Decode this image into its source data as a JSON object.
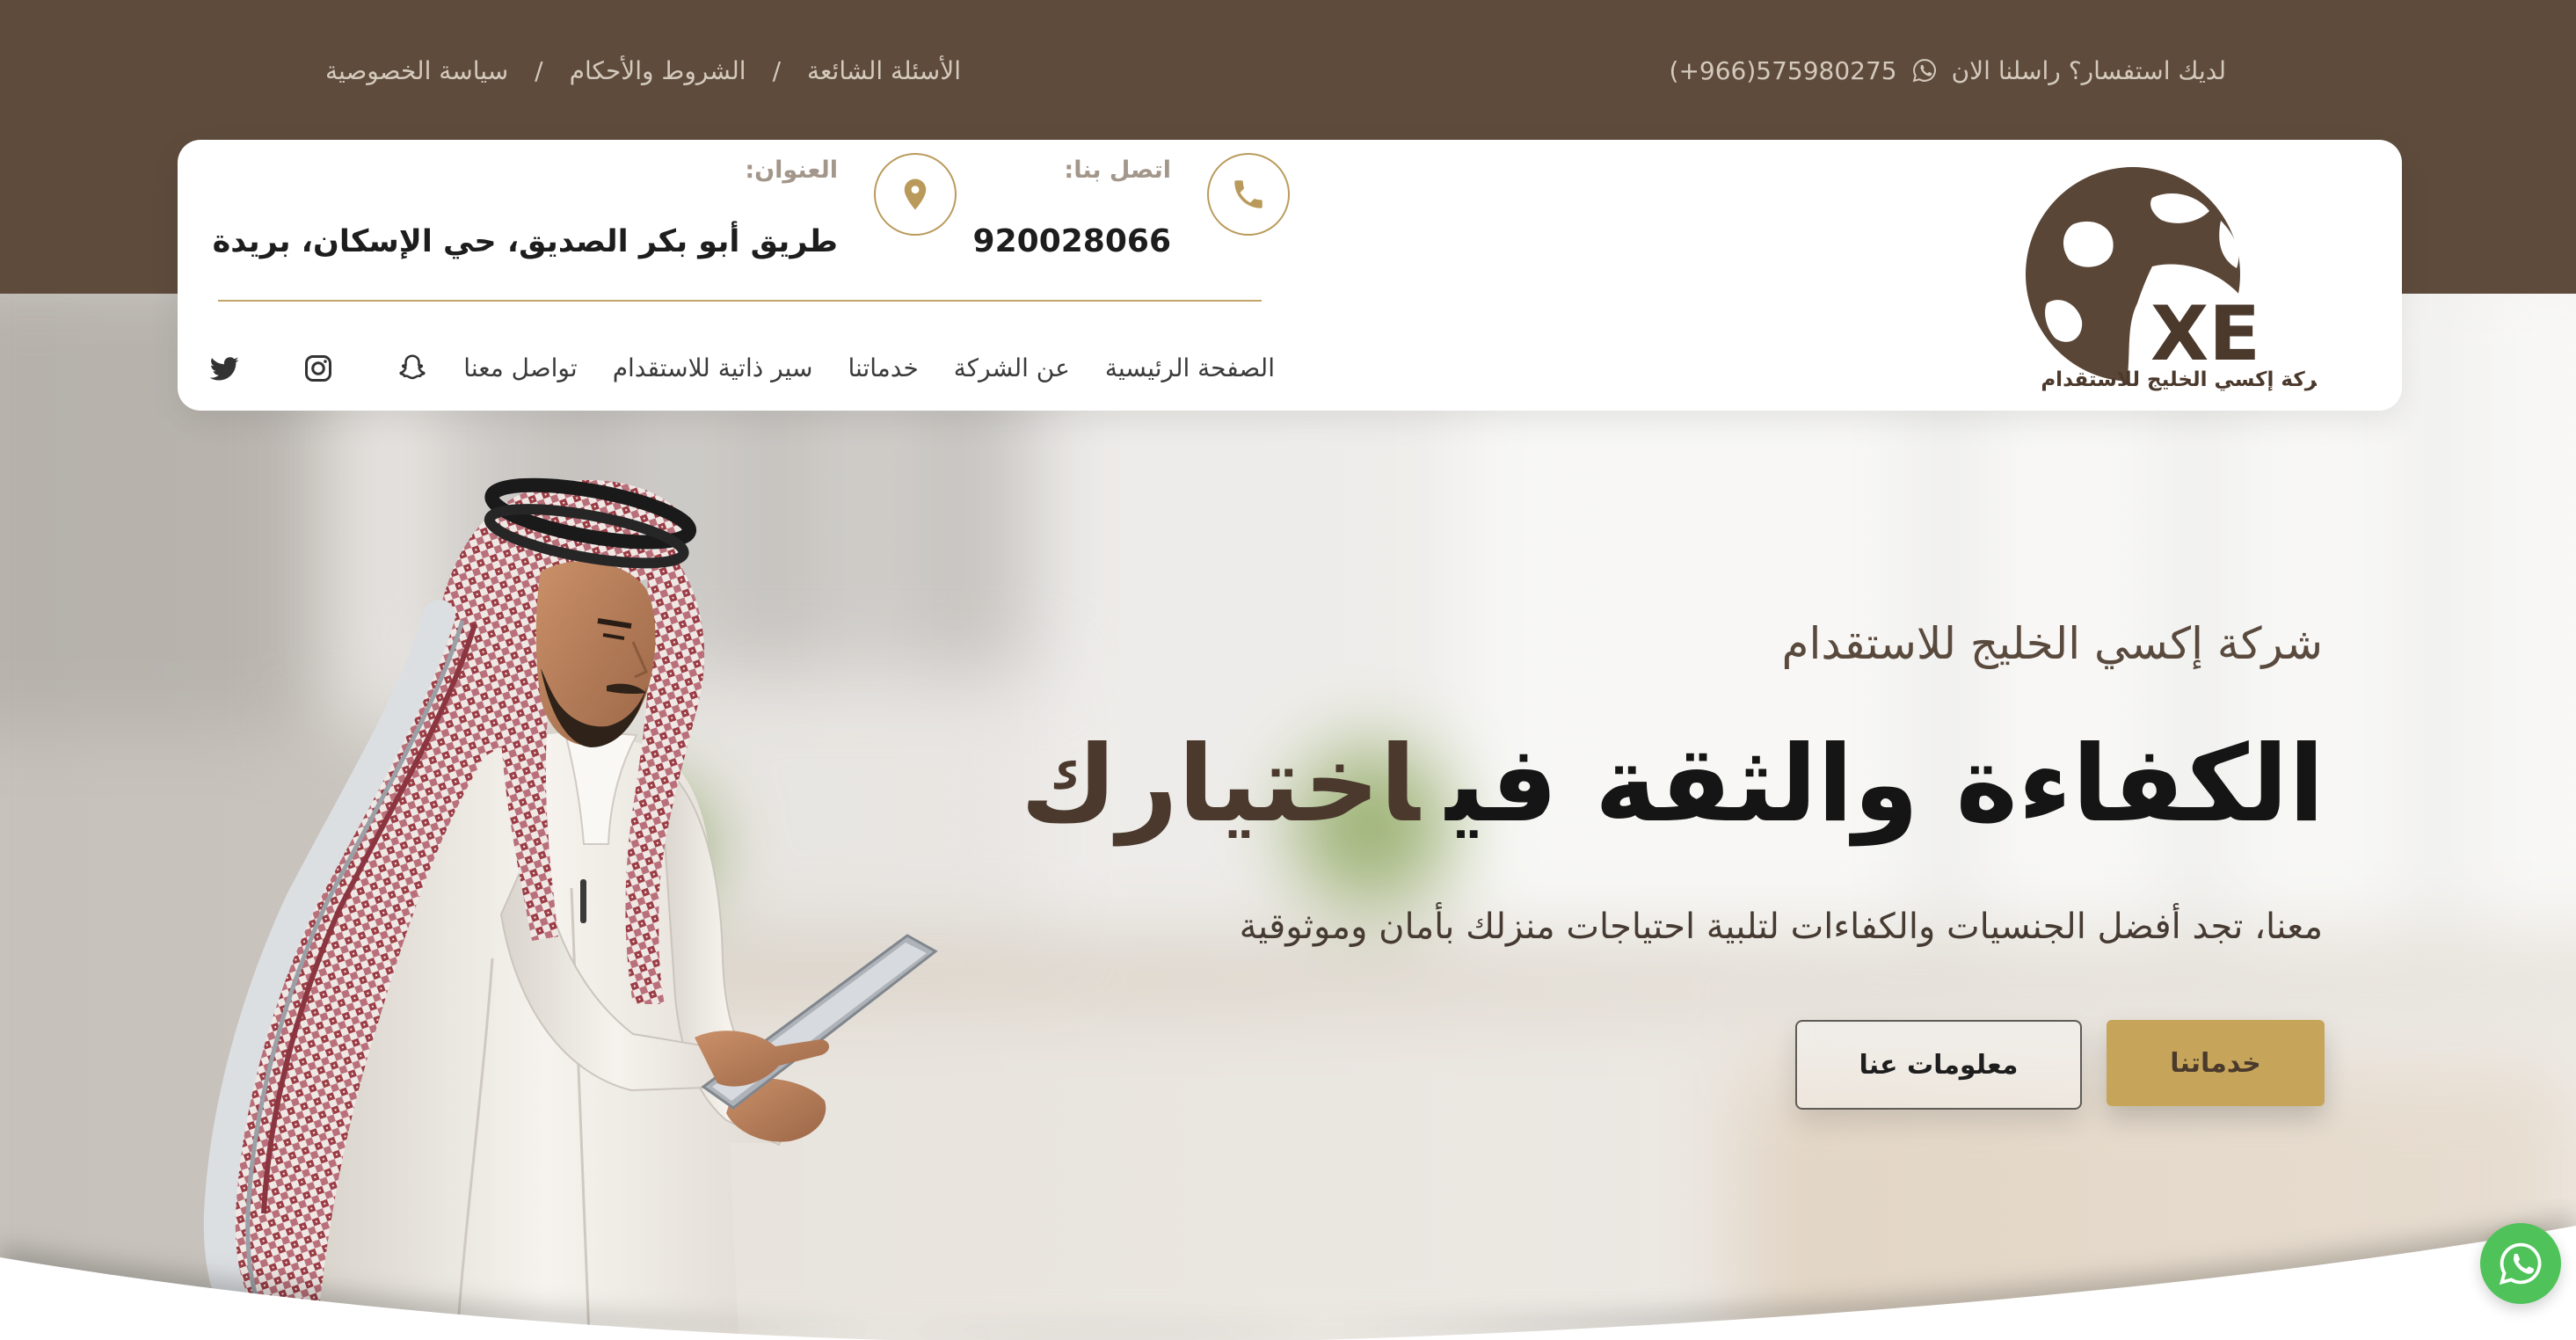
{
  "topbar": {
    "inquiry_text": "لديك استفسار؟ راسلنا الان",
    "whatsapp_phone": "(+966)575980275",
    "contact_icon": "whatsapp-icon",
    "links": [
      "الأسئلة الشائعة",
      "الشروط والأحكام",
      "سياسة الخصوصية"
    ],
    "separator": "/"
  },
  "brand": {
    "logo_mark": "XE",
    "logo_tagline": "شركة إكسي الخليج للاستقدام"
  },
  "contact": {
    "call_icon": "phone-icon",
    "call_label": "اتصل بنا:",
    "call_number": "920028066",
    "address_icon": "location-pin-icon",
    "address_label": "العنوان:",
    "address": "طريق أبو بكر الصديق، حي الإسكان، بريدة"
  },
  "nav": {
    "items": [
      "الصفحة الرئيسية",
      "عن الشركة",
      "خدماتنا",
      "سير ذاتية للاستقدام",
      "تواصل معنا"
    ]
  },
  "social": {
    "icons": [
      "snapchat-icon",
      "instagram-icon",
      "twitter-icon"
    ]
  },
  "hero": {
    "kicker": "شركة إكسي الخليج للاستقدام",
    "title_main": "الكفاءة والثقة في",
    "title_accent": "اختيارك",
    "subtitle": "معنا، تجد أفضل الجنسيات والكفاءات لتلبية احتياجات منزلك بأمان وموثوقية",
    "primary_button": "خدماتنا",
    "secondary_button": "معلومات عنا"
  },
  "floating": {
    "icon": "whatsapp-icon"
  },
  "colors": {
    "topbar_bg": "#5e4b3c",
    "gold": "#c6a55a",
    "accent_brown": "#4a392c",
    "text_dark": "#151515",
    "whatsapp_green": "#4fc35a"
  }
}
